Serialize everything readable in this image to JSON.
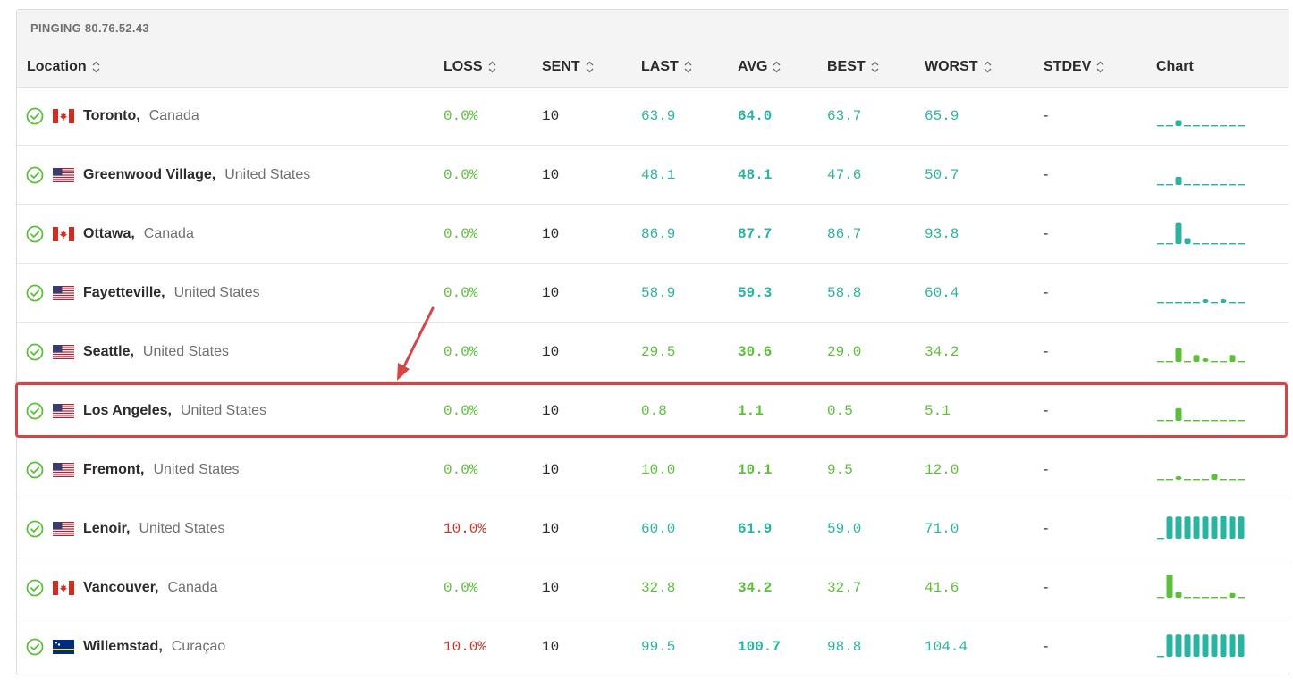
{
  "title": "PINGING 80.76.52.43",
  "columns": {
    "location": "Location",
    "loss": "LOSS",
    "sent": "SENT",
    "last": "LAST",
    "avg": "AVG",
    "best": "BEST",
    "worst": "WORST",
    "stdev": "STDEV",
    "chart": "Chart"
  },
  "colors": {
    "green": "#5bbf3a",
    "teal": "#2ab3a0",
    "red": "#c0392b",
    "highlight": "#d64545"
  },
  "rows": [
    {
      "city": "Toronto,",
      "country": "Canada",
      "flag": "canada-flag",
      "loss": "0.0%",
      "sent": "10",
      "last": "63.9",
      "avg": "64.0",
      "best": "63.7",
      "worst": "65.9",
      "stdev": "-",
      "tone": "teal",
      "loss_tone": "green",
      "chart": [
        0,
        0,
        0.25,
        0,
        0,
        0,
        0,
        0,
        0,
        0
      ]
    },
    {
      "city": "Greenwood Village,",
      "country": "United States",
      "flag": "us-flag",
      "loss": "0.0%",
      "sent": "10",
      "last": "48.1",
      "avg": "48.1",
      "best": "47.6",
      "worst": "50.7",
      "stdev": "-",
      "tone": "teal",
      "loss_tone": "green",
      "chart": [
        0,
        0,
        0.35,
        0,
        0,
        0,
        0,
        0,
        0,
        0
      ]
    },
    {
      "city": "Ottawa,",
      "country": "Canada",
      "flag": "canada-flag",
      "loss": "0.0%",
      "sent": "10",
      "last": "86.9",
      "avg": "87.7",
      "best": "86.7",
      "worst": "93.8",
      "stdev": "-",
      "tone": "teal",
      "loss_tone": "green",
      "chart": [
        0,
        0,
        0.9,
        0.25,
        0,
        0,
        0,
        0,
        0,
        0
      ]
    },
    {
      "city": "Fayetteville,",
      "country": "United States",
      "flag": "us-flag",
      "loss": "0.0%",
      "sent": "10",
      "last": "58.9",
      "avg": "59.3",
      "best": "58.8",
      "worst": "60.4",
      "stdev": "-",
      "tone": "teal",
      "loss_tone": "green",
      "chart": [
        0,
        0,
        0,
        0,
        0,
        0.15,
        0,
        0.1,
        0,
        0
      ]
    },
    {
      "city": "Seattle,",
      "country": "United States",
      "flag": "us-flag",
      "loss": "0.0%",
      "sent": "10",
      "last": "29.5",
      "avg": "30.6",
      "best": "29.0",
      "worst": "34.2",
      "stdev": "-",
      "tone": "green",
      "loss_tone": "green",
      "chart": [
        0,
        0,
        0.6,
        0,
        0.3,
        0.15,
        0,
        0,
        0.3,
        0
      ]
    },
    {
      "city": "Los Angeles,",
      "country": "United States",
      "flag": "us-flag",
      "loss": "0.0%",
      "sent": "10",
      "last": "0.8",
      "avg": "1.1",
      "best": "0.5",
      "worst": "5.1",
      "stdev": "-",
      "tone": "green",
      "loss_tone": "green",
      "chart": [
        0,
        0,
        0.55,
        0,
        0,
        0,
        0,
        0,
        0,
        0
      ]
    },
    {
      "city": "Fremont,",
      "country": "United States",
      "flag": "us-flag",
      "loss": "0.0%",
      "sent": "10",
      "last": "10.0",
      "avg": "10.1",
      "best": "9.5",
      "worst": "12.0",
      "stdev": "-",
      "tone": "green",
      "loss_tone": "green",
      "chart": [
        0,
        0,
        0.1,
        0,
        0,
        0,
        0.25,
        0,
        0,
        0
      ]
    },
    {
      "city": "Lenoir,",
      "country": "United States",
      "flag": "us-flag",
      "loss": "10.0%",
      "sent": "10",
      "last": "60.0",
      "avg": "61.9",
      "best": "59.0",
      "worst": "71.0",
      "stdev": "-",
      "tone": "teal",
      "loss_tone": "red",
      "chart": [
        0,
        0.95,
        0.95,
        0.95,
        0.95,
        0.95,
        0.95,
        1.0,
        0.95,
        0.95
      ]
    },
    {
      "city": "Vancouver,",
      "country": "Canada",
      "flag": "canada-flag",
      "loss": "0.0%",
      "sent": "10",
      "last": "32.8",
      "avg": "34.2",
      "best": "32.7",
      "worst": "41.6",
      "stdev": "-",
      "tone": "green",
      "loss_tone": "green",
      "chart": [
        0,
        1.0,
        0.25,
        0,
        0,
        0,
        0,
        0,
        0.2,
        0
      ]
    },
    {
      "city": "Willemstad,",
      "country": "Curaçao",
      "flag": "curacao-flag",
      "loss": "10.0%",
      "sent": "10",
      "last": "99.5",
      "avg": "100.7",
      "best": "98.8",
      "worst": "104.4",
      "stdev": "-",
      "tone": "teal",
      "loss_tone": "red",
      "chart": [
        0,
        0.95,
        0.95,
        0.95,
        0.95,
        0.95,
        0.95,
        0.95,
        0.95,
        0.95
      ]
    }
  ]
}
